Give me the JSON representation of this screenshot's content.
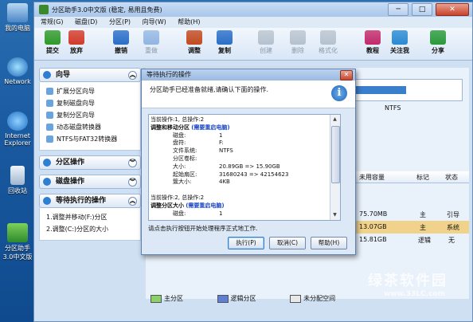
{
  "desktop": {
    "icons": [
      {
        "label": "我的电脑",
        "icon": "computer-icon"
      },
      {
        "label": "Network",
        "icon": "network-icon"
      },
      {
        "label": "Internet Explorer",
        "icon": "ie-icon"
      },
      {
        "label": "回收站",
        "icon": "recycle-bin-icon"
      },
      {
        "label": "分区助手3.0中文版",
        "icon": "partition-assistant-icon"
      }
    ]
  },
  "window": {
    "title": "分区助手3.0中文版 (稳定, 易用且免费)",
    "controls": {
      "minimize": "─",
      "maximize": "□",
      "close": "✕"
    }
  },
  "menu": [
    "常规(G)",
    "磁盘(D)",
    "分区(P)",
    "向导(W)",
    "帮助(H)"
  ],
  "toolbar": [
    {
      "label": "提交",
      "icon": "commit-check-icon",
      "color": "#2f9a2a",
      "enabled": true
    },
    {
      "label": "放弃",
      "icon": "discard-x-icon",
      "color": "#d23a2a",
      "enabled": true
    },
    {
      "label": "撤销",
      "icon": "undo-icon",
      "color": "#2a6ec8",
      "enabled": true
    },
    {
      "label": "重做",
      "icon": "redo-icon",
      "color": "#2a6ec8",
      "enabled": false
    },
    {
      "label": "调整",
      "icon": "resize-icon",
      "color": "#c24a1e",
      "enabled": true
    },
    {
      "label": "复制",
      "icon": "copy-icon",
      "color": "#2a6ec8",
      "enabled": true
    },
    {
      "label": "创建",
      "icon": "create-icon",
      "color": "#7a8a9a",
      "enabled": false
    },
    {
      "label": "删除",
      "icon": "delete-icon",
      "color": "#7a8a9a",
      "enabled": false
    },
    {
      "label": "格式化",
      "icon": "format-icon",
      "color": "#7a8a9a",
      "enabled": false
    },
    {
      "label": "教程",
      "icon": "tutorial-icon",
      "color": "#c22a6a",
      "enabled": true
    },
    {
      "label": "关注我",
      "icon": "follow-icon",
      "color": "#2a8ad2",
      "enabled": true
    },
    {
      "label": "分享",
      "icon": "share-icon",
      "color": "#2a9a3a",
      "enabled": true
    }
  ],
  "left_panel": {
    "wizard": {
      "title": "向导",
      "items": [
        "扩展分区向导",
        "复制磁盘向导",
        "复制分区向导",
        "动态磁盘转换器",
        "NTFS与FAT32转换器"
      ]
    },
    "partition_ops": {
      "title": "分区操作"
    },
    "disk_ops": {
      "title": "磁盘操作"
    },
    "pending": {
      "title": "等待执行的操作",
      "items": [
        "1.调整并移动(F:)分区",
        "2.调整(C:)分区的大小"
      ]
    }
  },
  "right_panel": {
    "disk_label_fragment": "NTFS",
    "columns": [
      "未用容量",
      "标记",
      "状态"
    ],
    "rows": [
      {
        "unused": "75.70MB",
        "flag": "主",
        "status": "引导",
        "selected": false
      },
      {
        "unused": "13.07GB",
        "flag": "主",
        "status": "系统",
        "selected": true
      },
      {
        "unused": "15.81GB",
        "flag": "逻辑",
        "status": "无",
        "selected": false
      }
    ]
  },
  "legend": [
    {
      "label": "主分区",
      "color": "#8bd16a"
    },
    {
      "label": "逻辑分区",
      "color": "#5f7fd6"
    },
    {
      "label": "未分配空间",
      "color": "#e8e8e8"
    }
  ],
  "dialog": {
    "title": "等待执行的操作",
    "message": "分区助手已经准备就绪,请确认下面的操作.",
    "op1": {
      "header": "当前操作:1, 总操作:2",
      "name": "调整和移动分区",
      "reboot": "(需要重启电脑)",
      "fields": [
        {
          "k": "磁盘:",
          "v": "1"
        },
        {
          "k": "盘符:",
          "v": "F:"
        },
        {
          "k": "文件系统:",
          "v": "NTFS"
        },
        {
          "k": "分区卷标:",
          "v": ""
        },
        {
          "k": "大小:",
          "v": "20.89GB => 15.90GB"
        },
        {
          "k": "起始扇区:",
          "v": "31680243 => 42154623"
        },
        {
          "k": "簇大小:",
          "v": "4KB"
        }
      ]
    },
    "op2": {
      "header": "当前操作:2, 总操作:2",
      "name": "调整分区大小",
      "reboot": "(需要重启电脑)",
      "fields": [
        {
          "k": "磁盘:",
          "v": "1"
        }
      ]
    },
    "hint": "请点击执行按钮开始处理程序正式地工作.",
    "buttons": {
      "execute": "执行(P)",
      "cancel": "取消(C)",
      "help": "帮助(H)"
    }
  },
  "watermark": {
    "line1": "绿茶软件园",
    "line2": "www.33LC.com"
  }
}
